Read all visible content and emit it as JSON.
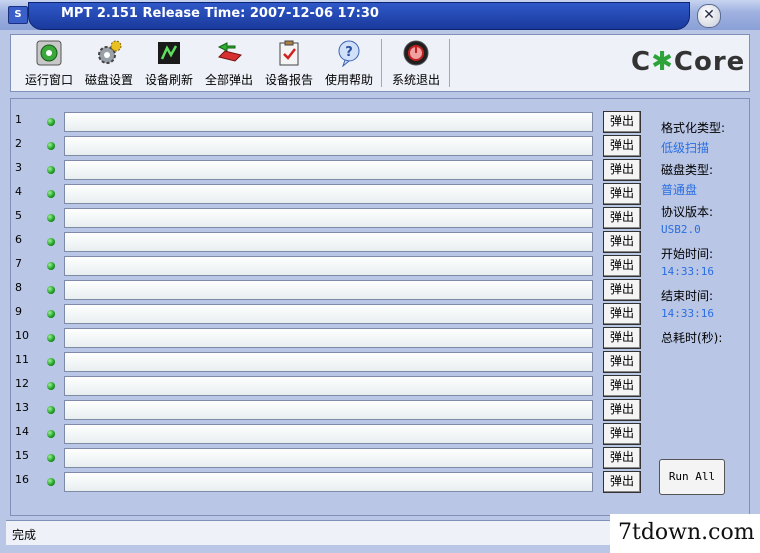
{
  "window": {
    "title": "MPT 2.151 Release Time: 2007-12-06 17:30",
    "app_icon": "S",
    "close_glyph": "✕"
  },
  "toolbar": {
    "items": [
      {
        "label": "运行窗口",
        "icon": "run-window-icon"
      },
      {
        "label": "磁盘设置",
        "icon": "gear-icon"
      },
      {
        "label": "设备刷新",
        "icon": "refresh-icon"
      },
      {
        "label": "全部弹出",
        "icon": "eject-all-icon"
      },
      {
        "label": "设备报告",
        "icon": "report-icon"
      },
      {
        "label": "使用帮助",
        "icon": "help-icon"
      },
      {
        "label": "系统退出",
        "icon": "exit-icon"
      }
    ],
    "logo": {
      "left": "C",
      "star": "✱",
      "right": "Core"
    }
  },
  "ports": [
    {
      "num": "1",
      "eject_label": "弹出"
    },
    {
      "num": "2",
      "eject_label": "弹出"
    },
    {
      "num": "3",
      "eject_label": "弹出"
    },
    {
      "num": "4",
      "eject_label": "弹出"
    },
    {
      "num": "5",
      "eject_label": "弹出"
    },
    {
      "num": "6",
      "eject_label": "弹出"
    },
    {
      "num": "7",
      "eject_label": "弹出"
    },
    {
      "num": "8",
      "eject_label": "弹出"
    },
    {
      "num": "9",
      "eject_label": "弹出"
    },
    {
      "num": "10",
      "eject_label": "弹出"
    },
    {
      "num": "11",
      "eject_label": "弹出"
    },
    {
      "num": "12",
      "eject_label": "弹出"
    },
    {
      "num": "13",
      "eject_label": "弹出"
    },
    {
      "num": "14",
      "eject_label": "弹出"
    },
    {
      "num": "15",
      "eject_label": "弹出"
    },
    {
      "num": "16",
      "eject_label": "弹出"
    }
  ],
  "info": {
    "format_type_label": "格式化类型:",
    "format_type_value": "低级扫描",
    "disk_type_label": "磁盘类型:",
    "disk_type_value": "普通盘",
    "protocol_label": "协议版本:",
    "protocol_value": "USB2.0",
    "start_label": "开始时间:",
    "start_value": "14:33:16",
    "end_label": "结束时间:",
    "end_value": "14:33:16",
    "elapsed_label": "总耗时(秒):"
  },
  "run_all_label": "Run All",
  "status": {
    "text": "完成"
  },
  "watermark": "7tdown.com",
  "colors": {
    "accent": "#2a6ee0",
    "led": "#1a9a1a",
    "title_bar": "#1a3a9c"
  }
}
